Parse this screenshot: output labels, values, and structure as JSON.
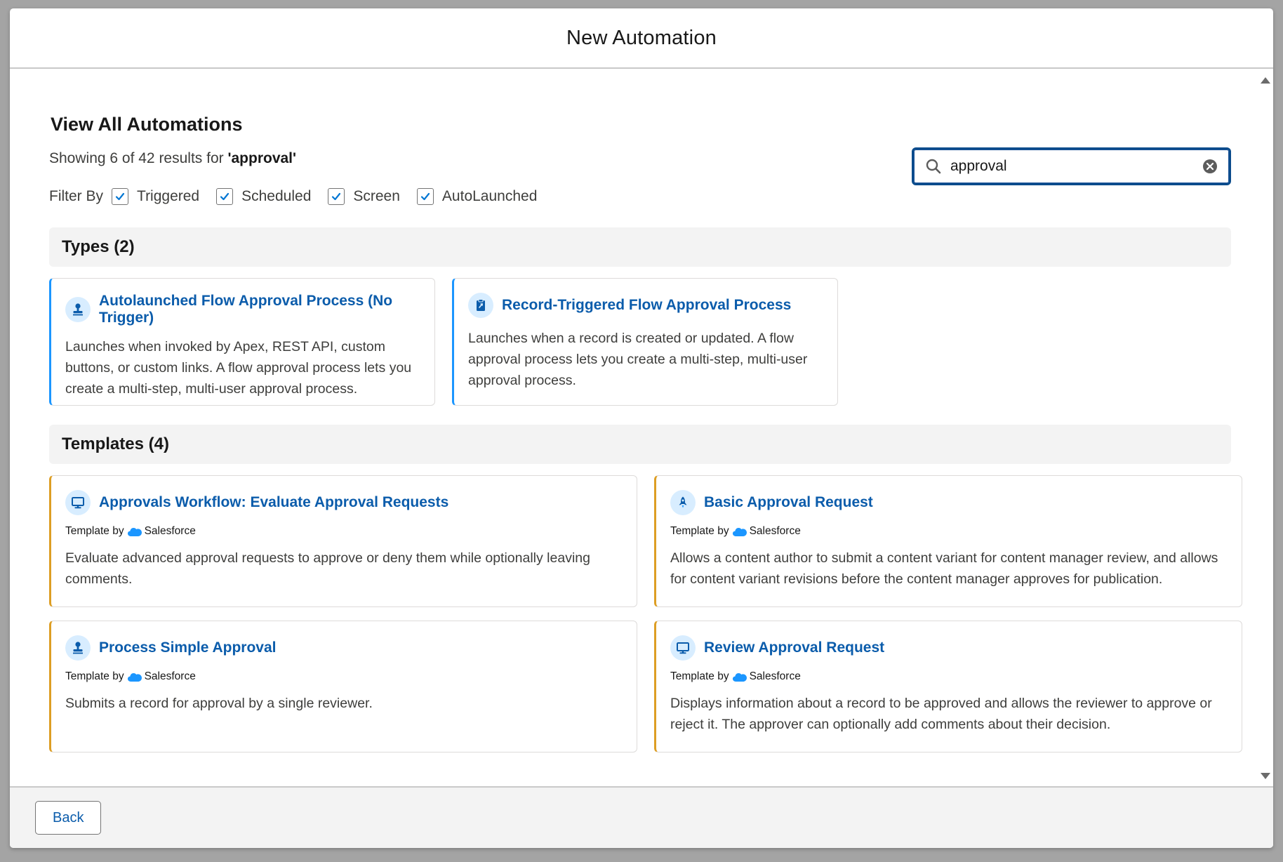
{
  "modal": {
    "title": "New Automation"
  },
  "heading": "View All Automations",
  "results": {
    "prefix": "Showing 6 of 42 results for ",
    "query": "'approval'"
  },
  "filter": {
    "label": "Filter By",
    "options": [
      {
        "label": "Triggered",
        "checked": true
      },
      {
        "label": "Scheduled",
        "checked": true
      },
      {
        "label": "Screen",
        "checked": true
      },
      {
        "label": "AutoLaunched",
        "checked": true
      }
    ]
  },
  "search": {
    "value": "approval"
  },
  "types": {
    "heading": "Types (2)",
    "cards": [
      {
        "icon": "stamp-icon",
        "title": "Autolaunched Flow Approval Process (No Trigger)",
        "description": "Launches when invoked by Apex, REST API, custom buttons, or custom links. A flow approval process lets you create a multi-step, multi-user approval process."
      },
      {
        "icon": "clipboard-icon",
        "title": "Record-Triggered Flow Approval Process",
        "description": "Launches when a record is created or updated. A flow approval process lets you create a multi-step, multi-user approval process."
      }
    ]
  },
  "templates": {
    "heading": "Templates (4)",
    "by_label": "Template by",
    "vendor": "Salesforce",
    "cards": [
      {
        "icon": "monitor-icon",
        "title": "Approvals Workflow: Evaluate Approval Requests",
        "description": "Evaluate advanced approval requests to approve or deny them while optionally leaving comments."
      },
      {
        "icon": "rocket-icon",
        "title": "Basic Approval Request",
        "description": "Allows a content author to submit a content variant for content manager review, and allows for content variant revisions before the content manager approves for publication."
      },
      {
        "icon": "stamp-icon",
        "title": "Process Simple Approval",
        "description": "Submits a record for approval by a single reviewer."
      },
      {
        "icon": "monitor-icon",
        "title": "Review Approval Request",
        "description": "Displays information about a record to be approved and allows the reviewer to approve or reject it. The approver can optionally add comments about their decision."
      }
    ]
  },
  "footer": {
    "back_label": "Back"
  },
  "colors": {
    "link": "#0b5cab",
    "type_accent": "#1b96ff",
    "template_accent": "#dd9e24",
    "focus_border": "#0b4c8c"
  }
}
